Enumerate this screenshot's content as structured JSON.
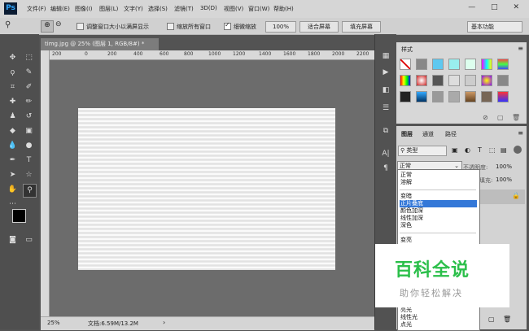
{
  "app": {
    "logo": "Ps"
  },
  "menu": [
    "文件(F)",
    "编辑(E)",
    "图像(I)",
    "图层(L)",
    "文字(Y)",
    "选择(S)",
    "滤镜(T)",
    "3D(D)",
    "视图(V)",
    "窗口(W)",
    "帮助(H)"
  ],
  "window_controls": "— □ ✕",
  "options": {
    "resize_windows": "调整窗口大小以满屏显示",
    "zoom_all": "缩放所有窗口",
    "scrubby_zoom": "细微缩放",
    "zoom_value": "100%",
    "fit_screen": "适合屏幕",
    "fill_screen": "填充屏幕",
    "workspace": "基本功能"
  },
  "document": {
    "tab_title": "timg.jpg @ 25% (图层 1, RGB/8#) *",
    "status_zoom": "25%",
    "status_doc": "文档:6.59M/13.2M",
    "ruler_ticks": [
      "200",
      "0",
      "200",
      "400",
      "600",
      "800",
      "1000",
      "1200",
      "1400",
      "1600",
      "1800",
      "2000",
      "2200"
    ]
  },
  "styles_panel": {
    "tab": "样式"
  },
  "layers_panel": {
    "tabs": [
      "图层",
      "通道",
      "路径"
    ],
    "filter_label": "类型",
    "blend_mode": "正常",
    "opacity_label": "不透明度:",
    "opacity_value": "100%",
    "fill_label": "填充:",
    "fill_value": "100%"
  },
  "blend_dropdown": {
    "group1": [
      "正常",
      "溶解"
    ],
    "group2": [
      "变暗",
      "正片叠底",
      "颜色加深",
      "线性加深",
      "深色"
    ],
    "group3": [
      "变亮"
    ],
    "group4": [
      "亮光",
      "线性光",
      "点光"
    ],
    "selected": "正片叠底"
  },
  "watermark": {
    "title": "百科全说",
    "subtitle": "助你轻松解决"
  },
  "colors": {
    "accent": "#3478d8",
    "watermark_green": "#2bbf4a",
    "ps_blue": "#31a8ff"
  }
}
